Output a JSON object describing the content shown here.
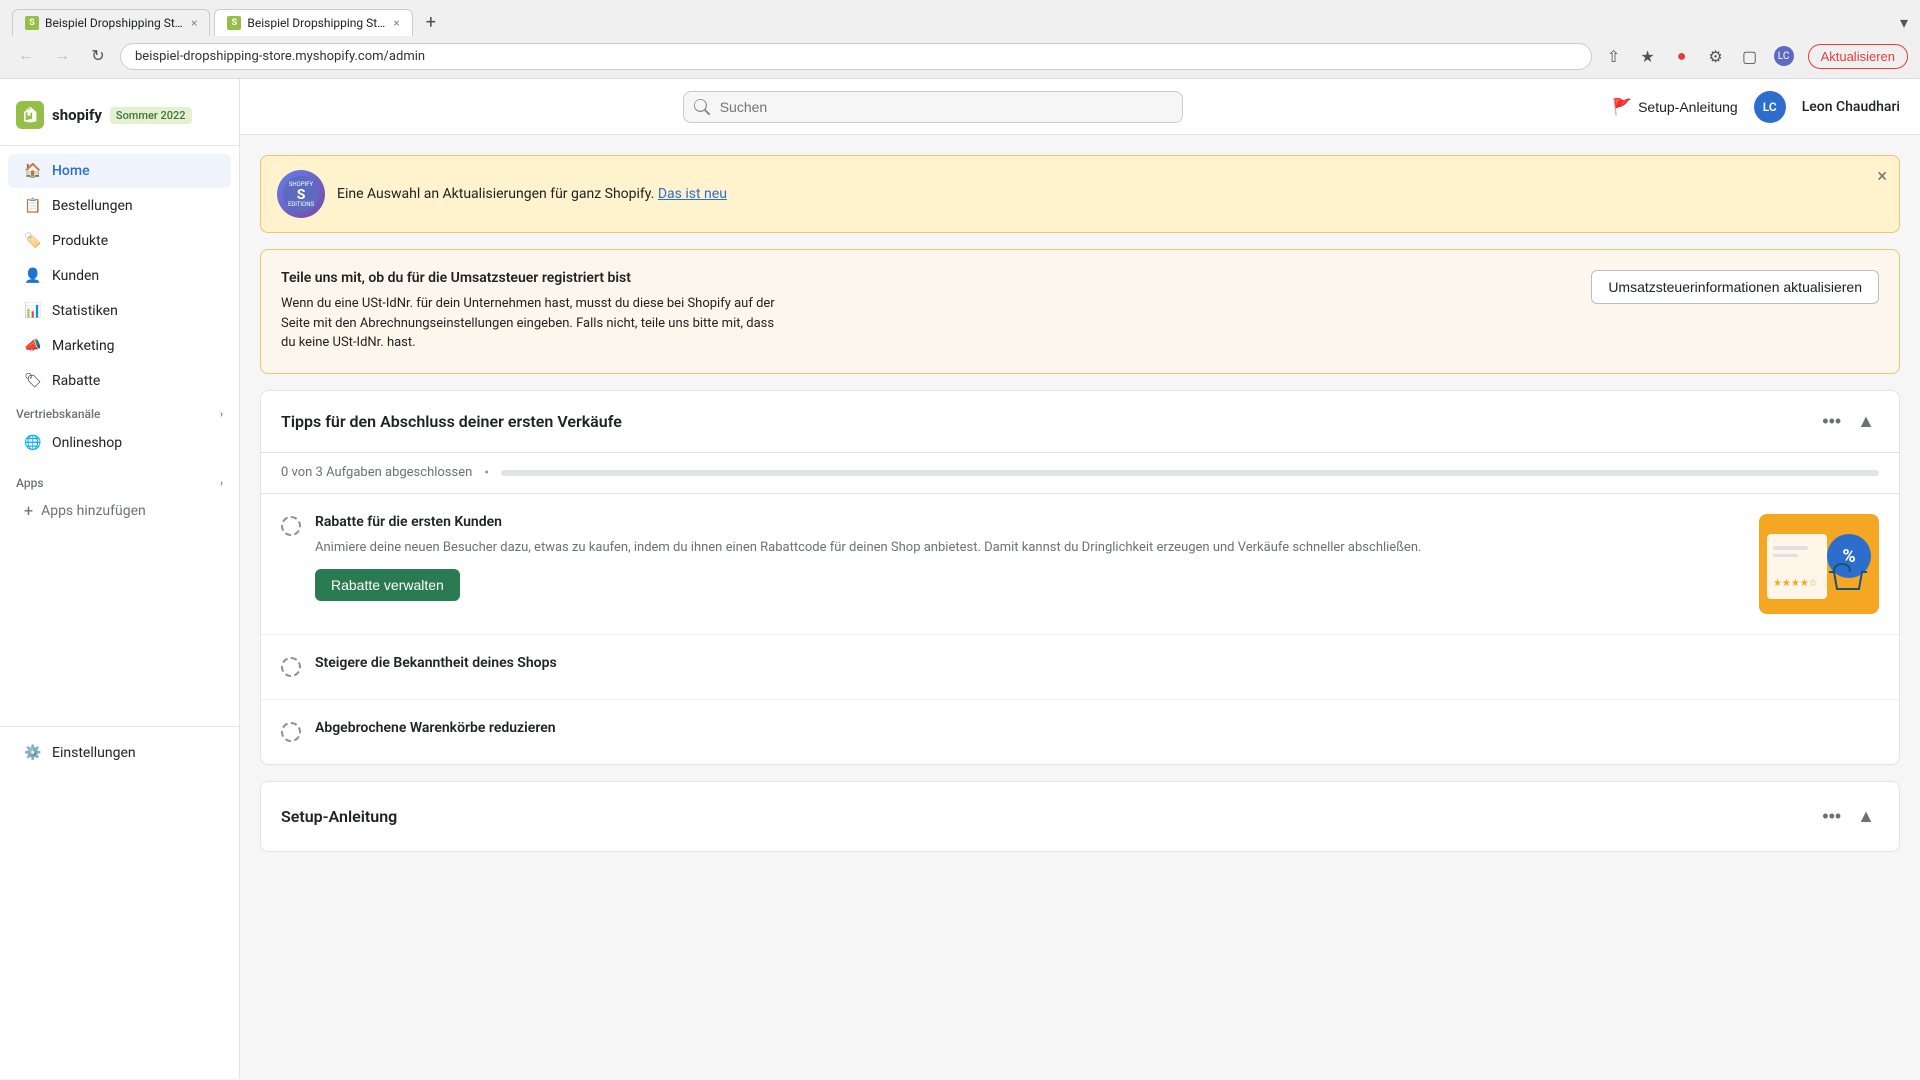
{
  "browser": {
    "tabs": [
      {
        "id": "tab1",
        "label": "Beispiel Dropshipping Store ·  ...",
        "active": true,
        "favicon": "S"
      },
      {
        "id": "tab2",
        "label": "Beispiel Dropshipping Store",
        "active": false,
        "favicon": "S"
      }
    ],
    "new_tab_label": "+",
    "dropdown_label": "▾",
    "address": "beispiel-dropshipping-store.myshopify.com/admin",
    "update_btn_label": "Aktualisieren"
  },
  "topbar": {
    "logo_letter": "S",
    "brand_name": "shopify",
    "season_badge": "Sommer 2022",
    "search_placeholder": "Suchen",
    "setup_guide_label": "Setup-Anleitung",
    "user_initials": "LC",
    "user_name": "Leon Chaudhari"
  },
  "sidebar": {
    "home_label": "Home",
    "bestellungen_label": "Bestellungen",
    "produkte_label": "Produkte",
    "kunden_label": "Kunden",
    "statistiken_label": "Statistiken",
    "marketing_label": "Marketing",
    "rabatte_label": "Rabatte",
    "vertriebskanaele_label": "Vertriebskanäle",
    "onlineshop_label": "Onlineshop",
    "apps_label": "Apps",
    "apps_hinzufuegen_label": "Apps hinzufügen",
    "einstellungen_label": "Einstellungen"
  },
  "banner": {
    "text": "Eine Auswahl an Aktualisierungen für ganz Shopify.",
    "link_text": "Das ist neu",
    "close_label": "×"
  },
  "tax_card": {
    "title": "Teile uns mit, ob du für die Umsatzsteuer registriert bist",
    "description": "Wenn du eine USt-IdNr. für dein Unternehmen hast, musst du diese bei Shopify auf der Seite mit den Abrechnungseinstellungen eingeben. Falls nicht, teile uns bitte mit, dass du keine USt-IdNr. hast.",
    "button_label": "Umsatzsteuerinformationen aktualisieren"
  },
  "tips_card": {
    "title": "Tipps für den Abschluss deiner ersten Verkäufe",
    "progress_text": "0 von 3 Aufgaben abgeschlossen",
    "progress_percent": 0,
    "more_icon": "···",
    "collapse_icon": "▲",
    "tasks": [
      {
        "id": "task1",
        "title": "Rabatte für die ersten Kunden",
        "description": "Animiere deine neuen Besucher dazu, etwas zu kaufen, indem du ihnen einen Rabattcode für deinen Shop anbietest. Damit kannst du Dringlichkeit erzeugen und Verkäufe schneller abschließen.",
        "button_label": "Rabatte verwalten",
        "has_image": true
      },
      {
        "id": "task2",
        "title": "Steigere die Bekanntheit deines Shops",
        "description": "",
        "button_label": "",
        "has_image": false
      },
      {
        "id": "task3",
        "title": "Abgebrochene Warenkörbe reduzieren",
        "description": "",
        "button_label": "",
        "has_image": false
      }
    ]
  },
  "setup_guide": {
    "title": "Setup-Anleitung"
  },
  "colors": {
    "accent_green": "#2a7a52",
    "accent_blue": "#2c6ecb",
    "shopify_green": "#96bf48"
  }
}
